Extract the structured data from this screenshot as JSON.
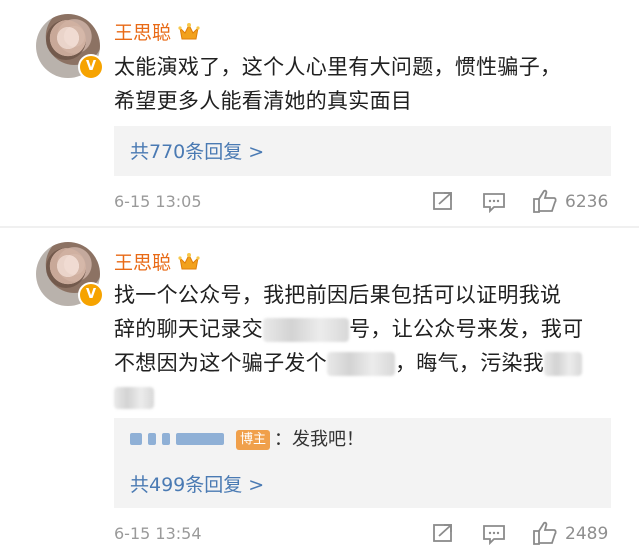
{
  "comments": [
    {
      "username": "王思聪",
      "text_lines": [
        "太能演戏了，这个人心里有大问题，惯性骗子，",
        "希望更多人能看清她的真实面目"
      ],
      "reply_count_label": "共770条回复 >",
      "time": "6-15 13:05",
      "like_count": "6236"
    },
    {
      "username": "王思聪",
      "text_lines": [
        "找一个公众号，我把前因后果包括可以证明我说",
        "辞的聊天记录交",
        "号，让公众号来发，我可",
        "不想因为这个骗子发个",
        "，晦气，污染我"
      ],
      "reply": {
        "author_badge": "博主",
        "text": "：发我吧！"
      },
      "reply_count_label": "共499条回复 >",
      "time": "6-15 13:54",
      "like_count": "2489"
    }
  ],
  "icons": {
    "verified": "v-badge-icon",
    "vip_crown": "crown-icon",
    "repost": "repost-icon",
    "comment": "comment-icon",
    "like": "thumbs-up-icon"
  },
  "colors": {
    "username": "#e86a16",
    "link": "#4a7ab3",
    "muted": "#9a9a9a",
    "reply_bg": "#f3f3f3",
    "verified_badge": "#f6a300"
  }
}
